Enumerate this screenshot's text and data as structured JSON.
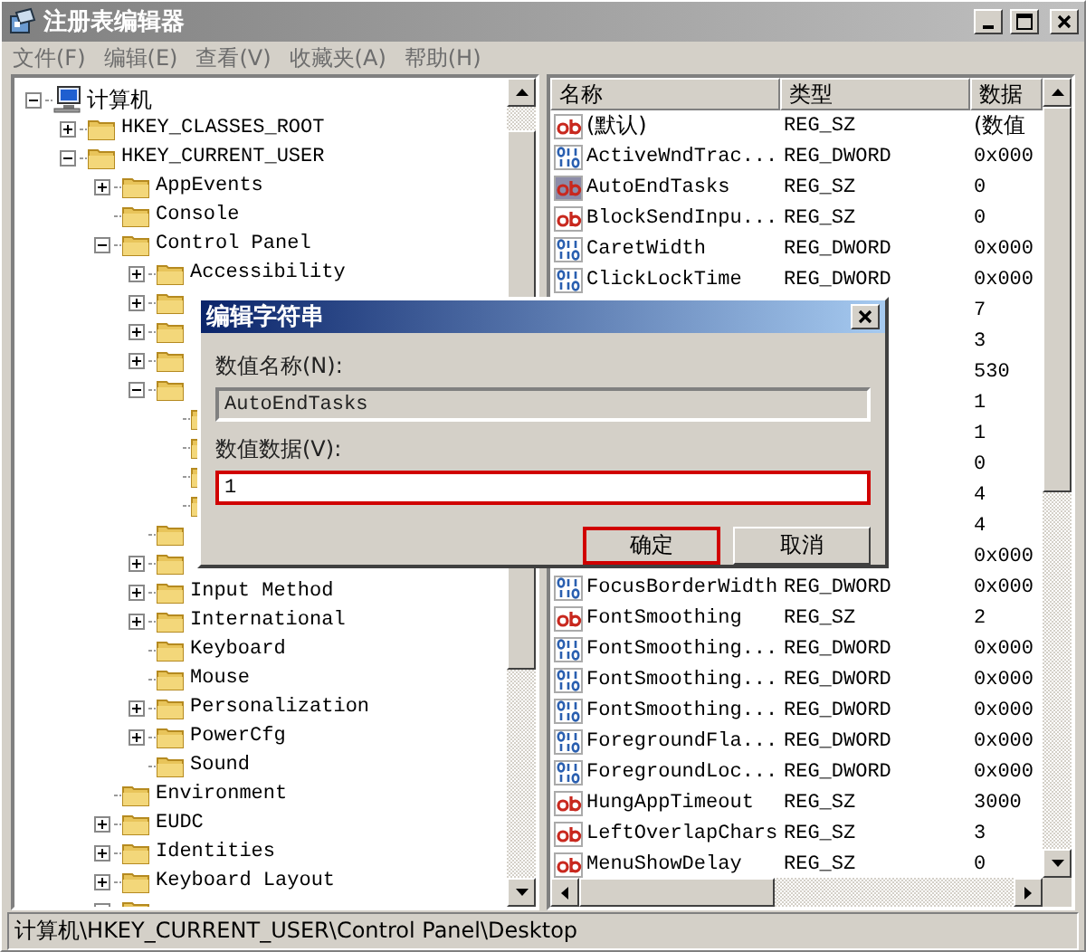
{
  "window": {
    "title": "注册表编辑器"
  },
  "menu": [
    "文件(F)",
    "编辑(E)",
    "查看(V)",
    "收藏夹(A)",
    "帮助(H)"
  ],
  "tree": [
    {
      "label": "计算机",
      "kind": "computer",
      "expanded": true,
      "children": [
        {
          "label": "HKEY_CLASSES_ROOT",
          "kind": "folder",
          "expanded": false
        },
        {
          "label": "HKEY_CURRENT_USER",
          "kind": "folder",
          "expanded": true,
          "children": [
            {
              "label": "AppEvents",
              "kind": "folder",
              "expanded": false
            },
            {
              "label": "Console",
              "kind": "folder"
            },
            {
              "label": "Control Panel",
              "kind": "folder",
              "expanded": true,
              "children": [
                {
                  "label": "Accessibility",
                  "kind": "folder",
                  "expanded": false
                },
                {
                  "kind": "folder",
                  "expanded": false
                },
                {
                  "kind": "folder",
                  "expanded": false
                },
                {
                  "kind": "folder",
                  "expanded": false
                },
                {
                  "kind": "folder",
                  "expanded": true,
                  "children": [
                    {
                      "kind": "folder"
                    },
                    {
                      "kind": "folder"
                    },
                    {
                      "kind": "folder"
                    },
                    {
                      "kind": "folder"
                    }
                  ]
                },
                {
                  "kind": "folder"
                },
                {
                  "kind": "folder",
                  "expanded": false
                },
                {
                  "label": "Input Method",
                  "kind": "folder",
                  "expanded": false
                },
                {
                  "label": "International",
                  "kind": "folder",
                  "expanded": false
                },
                {
                  "label": "Keyboard",
                  "kind": "folder"
                },
                {
                  "label": "Mouse",
                  "kind": "folder"
                },
                {
                  "label": "Personalization",
                  "kind": "folder",
                  "expanded": false
                },
                {
                  "label": "PowerCfg",
                  "kind": "folder",
                  "expanded": false
                },
                {
                  "label": "Sound",
                  "kind": "folder"
                }
              ]
            },
            {
              "label": "Environment",
              "kind": "folder"
            },
            {
              "label": "EUDC",
              "kind": "folder",
              "expanded": false
            },
            {
              "label": "Identities",
              "kind": "folder",
              "expanded": false
            },
            {
              "label": "Keyboard Layout",
              "kind": "folder",
              "expanded": false
            },
            {
              "kind": "folder",
              "expanded": false
            }
          ]
        }
      ]
    }
  ],
  "list": {
    "columns": [
      "名称",
      "类型",
      "数据"
    ],
    "rows": [
      {
        "kind": "string",
        "name": "(默认)",
        "type": "REG_SZ",
        "data": "(数值",
        "selected": false
      },
      {
        "kind": "dword",
        "name": "ActiveWndTrac...",
        "type": "REG_DWORD",
        "data": "0x000",
        "selected": false
      },
      {
        "kind": "string",
        "name": "AutoEndTasks",
        "type": "REG_SZ",
        "data": "0",
        "selected": true
      },
      {
        "kind": "string",
        "name": "BlockSendInpu...",
        "type": "REG_SZ",
        "data": "0",
        "selected": false
      },
      {
        "kind": "dword",
        "name": "CaretWidth",
        "type": "REG_DWORD",
        "data": "0x000",
        "selected": false
      },
      {
        "kind": "dword",
        "name": "ClickLockTime",
        "type": "REG_DWORD",
        "data": "0x000",
        "selected": false
      },
      {
        "data": "7"
      },
      {
        "data": "3"
      },
      {
        "data": "530"
      },
      {
        "data": "1"
      },
      {
        "data": "1"
      },
      {
        "data": "0"
      },
      {
        "data": "4"
      },
      {
        "data": "4"
      },
      {
        "data": "0x000"
      },
      {
        "kind": "dword",
        "name": "FocusBorderWidth",
        "type": "REG_DWORD",
        "data": "0x000",
        "selected": false
      },
      {
        "kind": "string",
        "name": "FontSmoothing",
        "type": "REG_SZ",
        "data": "2",
        "selected": false
      },
      {
        "kind": "dword",
        "name": "FontSmoothing...",
        "type": "REG_DWORD",
        "data": "0x000",
        "selected": false
      },
      {
        "kind": "dword",
        "name": "FontSmoothing...",
        "type": "REG_DWORD",
        "data": "0x000",
        "selected": false
      },
      {
        "kind": "dword",
        "name": "FontSmoothing...",
        "type": "REG_DWORD",
        "data": "0x000",
        "selected": false
      },
      {
        "kind": "dword",
        "name": "ForegroundFla...",
        "type": "REG_DWORD",
        "data": "0x000",
        "selected": false
      },
      {
        "kind": "dword",
        "name": "ForegroundLoc...",
        "type": "REG_DWORD",
        "data": "0x000",
        "selected": false
      },
      {
        "kind": "string",
        "name": "HungAppTimeout",
        "type": "REG_SZ",
        "data": "3000",
        "selected": false
      },
      {
        "kind": "string",
        "name": "LeftOverlapChars",
        "type": "REG_SZ",
        "data": "3",
        "selected": false
      },
      {
        "kind": "string",
        "name": "MenuShowDelay",
        "type": "REG_SZ",
        "data": "0",
        "selected": false
      }
    ]
  },
  "status_bar": "计算机\\HKEY_CURRENT_USER\\Control Panel\\Desktop",
  "dialog": {
    "title": "编辑字符串",
    "name_label": "数值名称(N):",
    "name_value": "AutoEndTasks",
    "name_disabled": true,
    "data_label": "数值数据(V):",
    "data_value": "1",
    "data_highlighted": true,
    "buttons": [
      {
        "label": "确定",
        "highlighted": true
      },
      {
        "label": "取消",
        "highlighted": false
      }
    ]
  }
}
